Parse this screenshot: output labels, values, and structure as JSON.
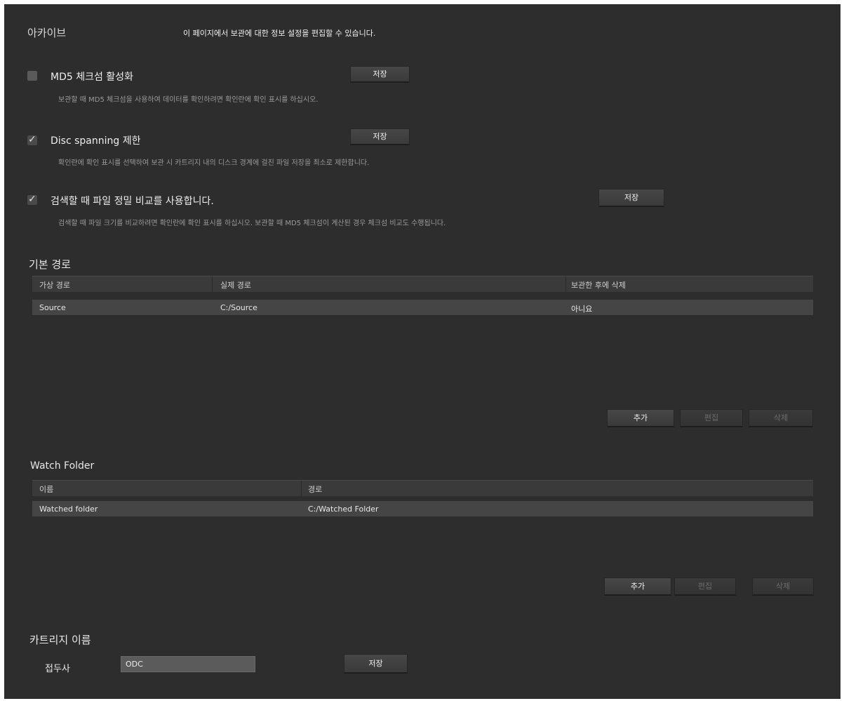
{
  "header": {
    "title": "아카이브",
    "description": "이 페이지에서 보관에 대한 정보 설정을 편집할 수 있습니다."
  },
  "options": [
    {
      "label": "MD5 체크섬 활성화",
      "checked": false,
      "description": "보관할 때 MD5 체크섬을 사용하여 데이터를 확인하려면 확인란에 확인 표시를 하십시오.",
      "save_label": "저장"
    },
    {
      "label": "Disc spanning 제한",
      "checked": true,
      "description": "확인란에 확인 표시를 선택하여 보관 시 카트리지 내의 디스크 경계에 걸친 파일 저장을 최소로 제한합니다.",
      "save_label": "저장"
    },
    {
      "label": "검색할 때 파일 정밀 비교를 사용합니다.",
      "checked": true,
      "description": "검색할 때 파일 크기를 비교하려면 확인란에 확인 표시를 하십시오. 보관할 때 MD5 체크섬이 계산된 경우 체크섬 비교도 수행됩니다.",
      "save_label": "저장"
    }
  ],
  "base_path": {
    "title": "기본 경로",
    "columns": [
      "가상 경로",
      "실제 경로",
      "보관한 후에 삭제"
    ],
    "rows": [
      [
        "Source",
        "C:/Source",
        "아니요"
      ]
    ],
    "buttons": {
      "add": "추가",
      "edit": "편집",
      "delete": "삭제"
    }
  },
  "watch_folder": {
    "title": "Watch Folder",
    "columns": [
      "이름",
      "경로"
    ],
    "rows": [
      [
        "Watched folder",
        "C:/Watched Folder"
      ]
    ],
    "buttons": {
      "add": "추가",
      "edit": "편집",
      "delete": "삭제"
    }
  },
  "cartridge": {
    "title": "카트리지 이름",
    "prefix_label": "접두사",
    "prefix_value": "ODC",
    "save_label": "저장"
  }
}
